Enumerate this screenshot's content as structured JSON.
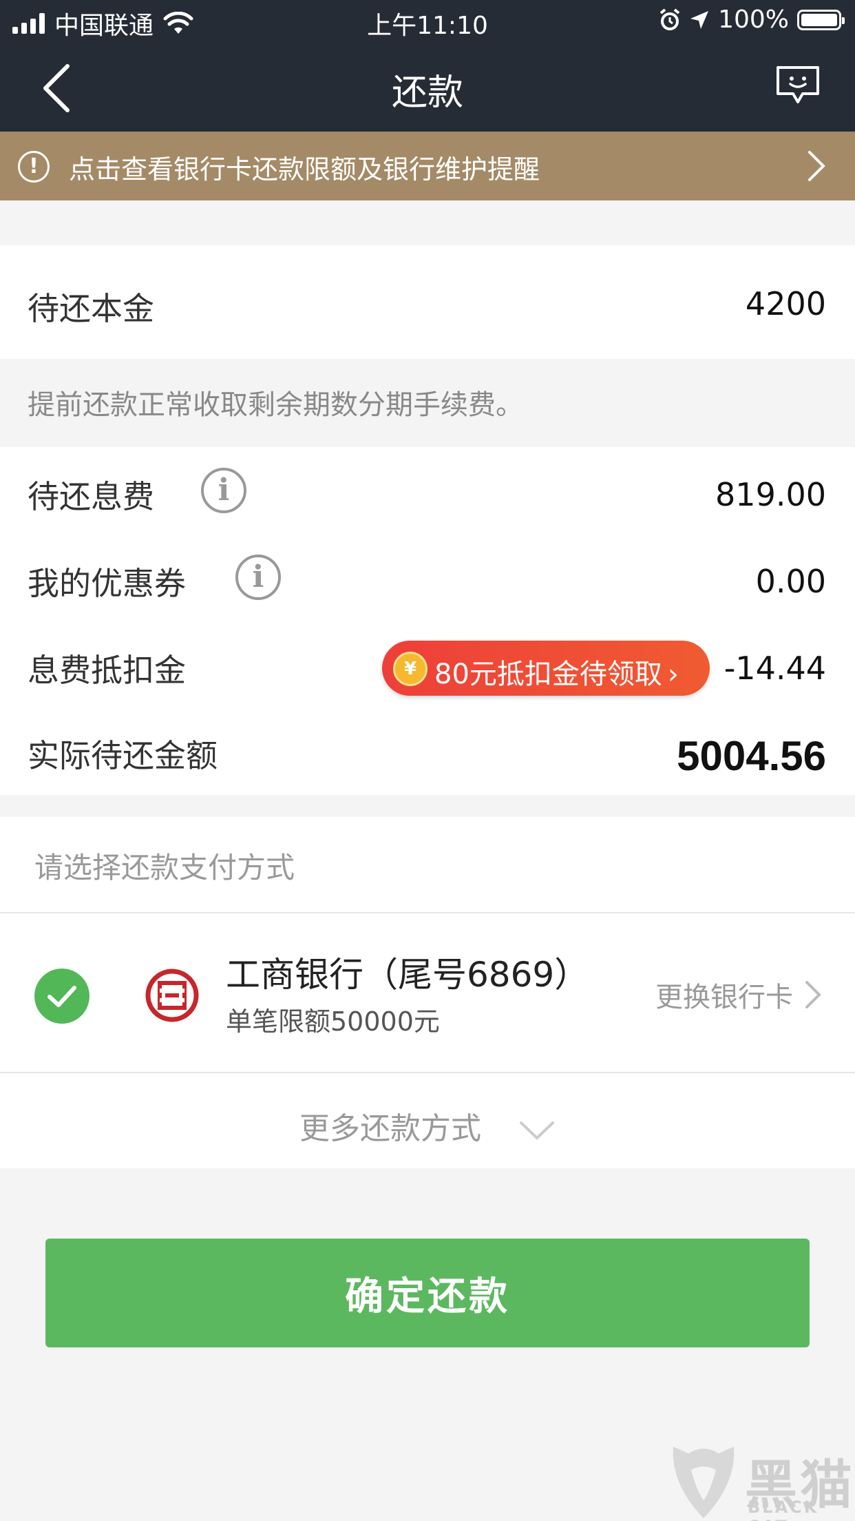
{
  "status_bar": {
    "carrier": "中国联通",
    "time": "上午11:10",
    "battery": "100%",
    "battery_level": 1.0
  },
  "nav": {
    "title": "还款",
    "back_icon": "chevron-left-icon",
    "chat_icon": "chat-bubble-icon"
  },
  "notice": {
    "text": "点击查看银行卡还款限额及银行维护提醒",
    "icon": "exclamation-circle-icon"
  },
  "principal": {
    "label": "待还本金",
    "value": "4200"
  },
  "note": "提前还款正常收取剩余期数分期手续费。",
  "interest": {
    "label": "待还息费",
    "value": "819.00"
  },
  "coupon": {
    "label": "我的优惠券",
    "value": "0.00"
  },
  "deduction": {
    "label": "息费抵扣金",
    "pill": "80元抵扣金待领取",
    "pill_arrow": "›",
    "coin_symbol": "¥",
    "value": "-14.44"
  },
  "total": {
    "label": "实际待还金额",
    "value": "5004.56"
  },
  "payment": {
    "title": "请选择还款支付方式",
    "bank_name": "工商银行（尾号6869）",
    "bank_limit": "单笔限额50000元",
    "change_card": "更换银行卡",
    "more_methods": "更多还款方式"
  },
  "confirm_button": "确定还款",
  "watermark": {
    "cn": "黑猫",
    "en": "BLACK CAT"
  },
  "colors": {
    "header_bg": "#262c36",
    "notice_bg": "#a48a66",
    "accent_green": "#5cb85f",
    "coupon_red": "#ee3f3a"
  }
}
